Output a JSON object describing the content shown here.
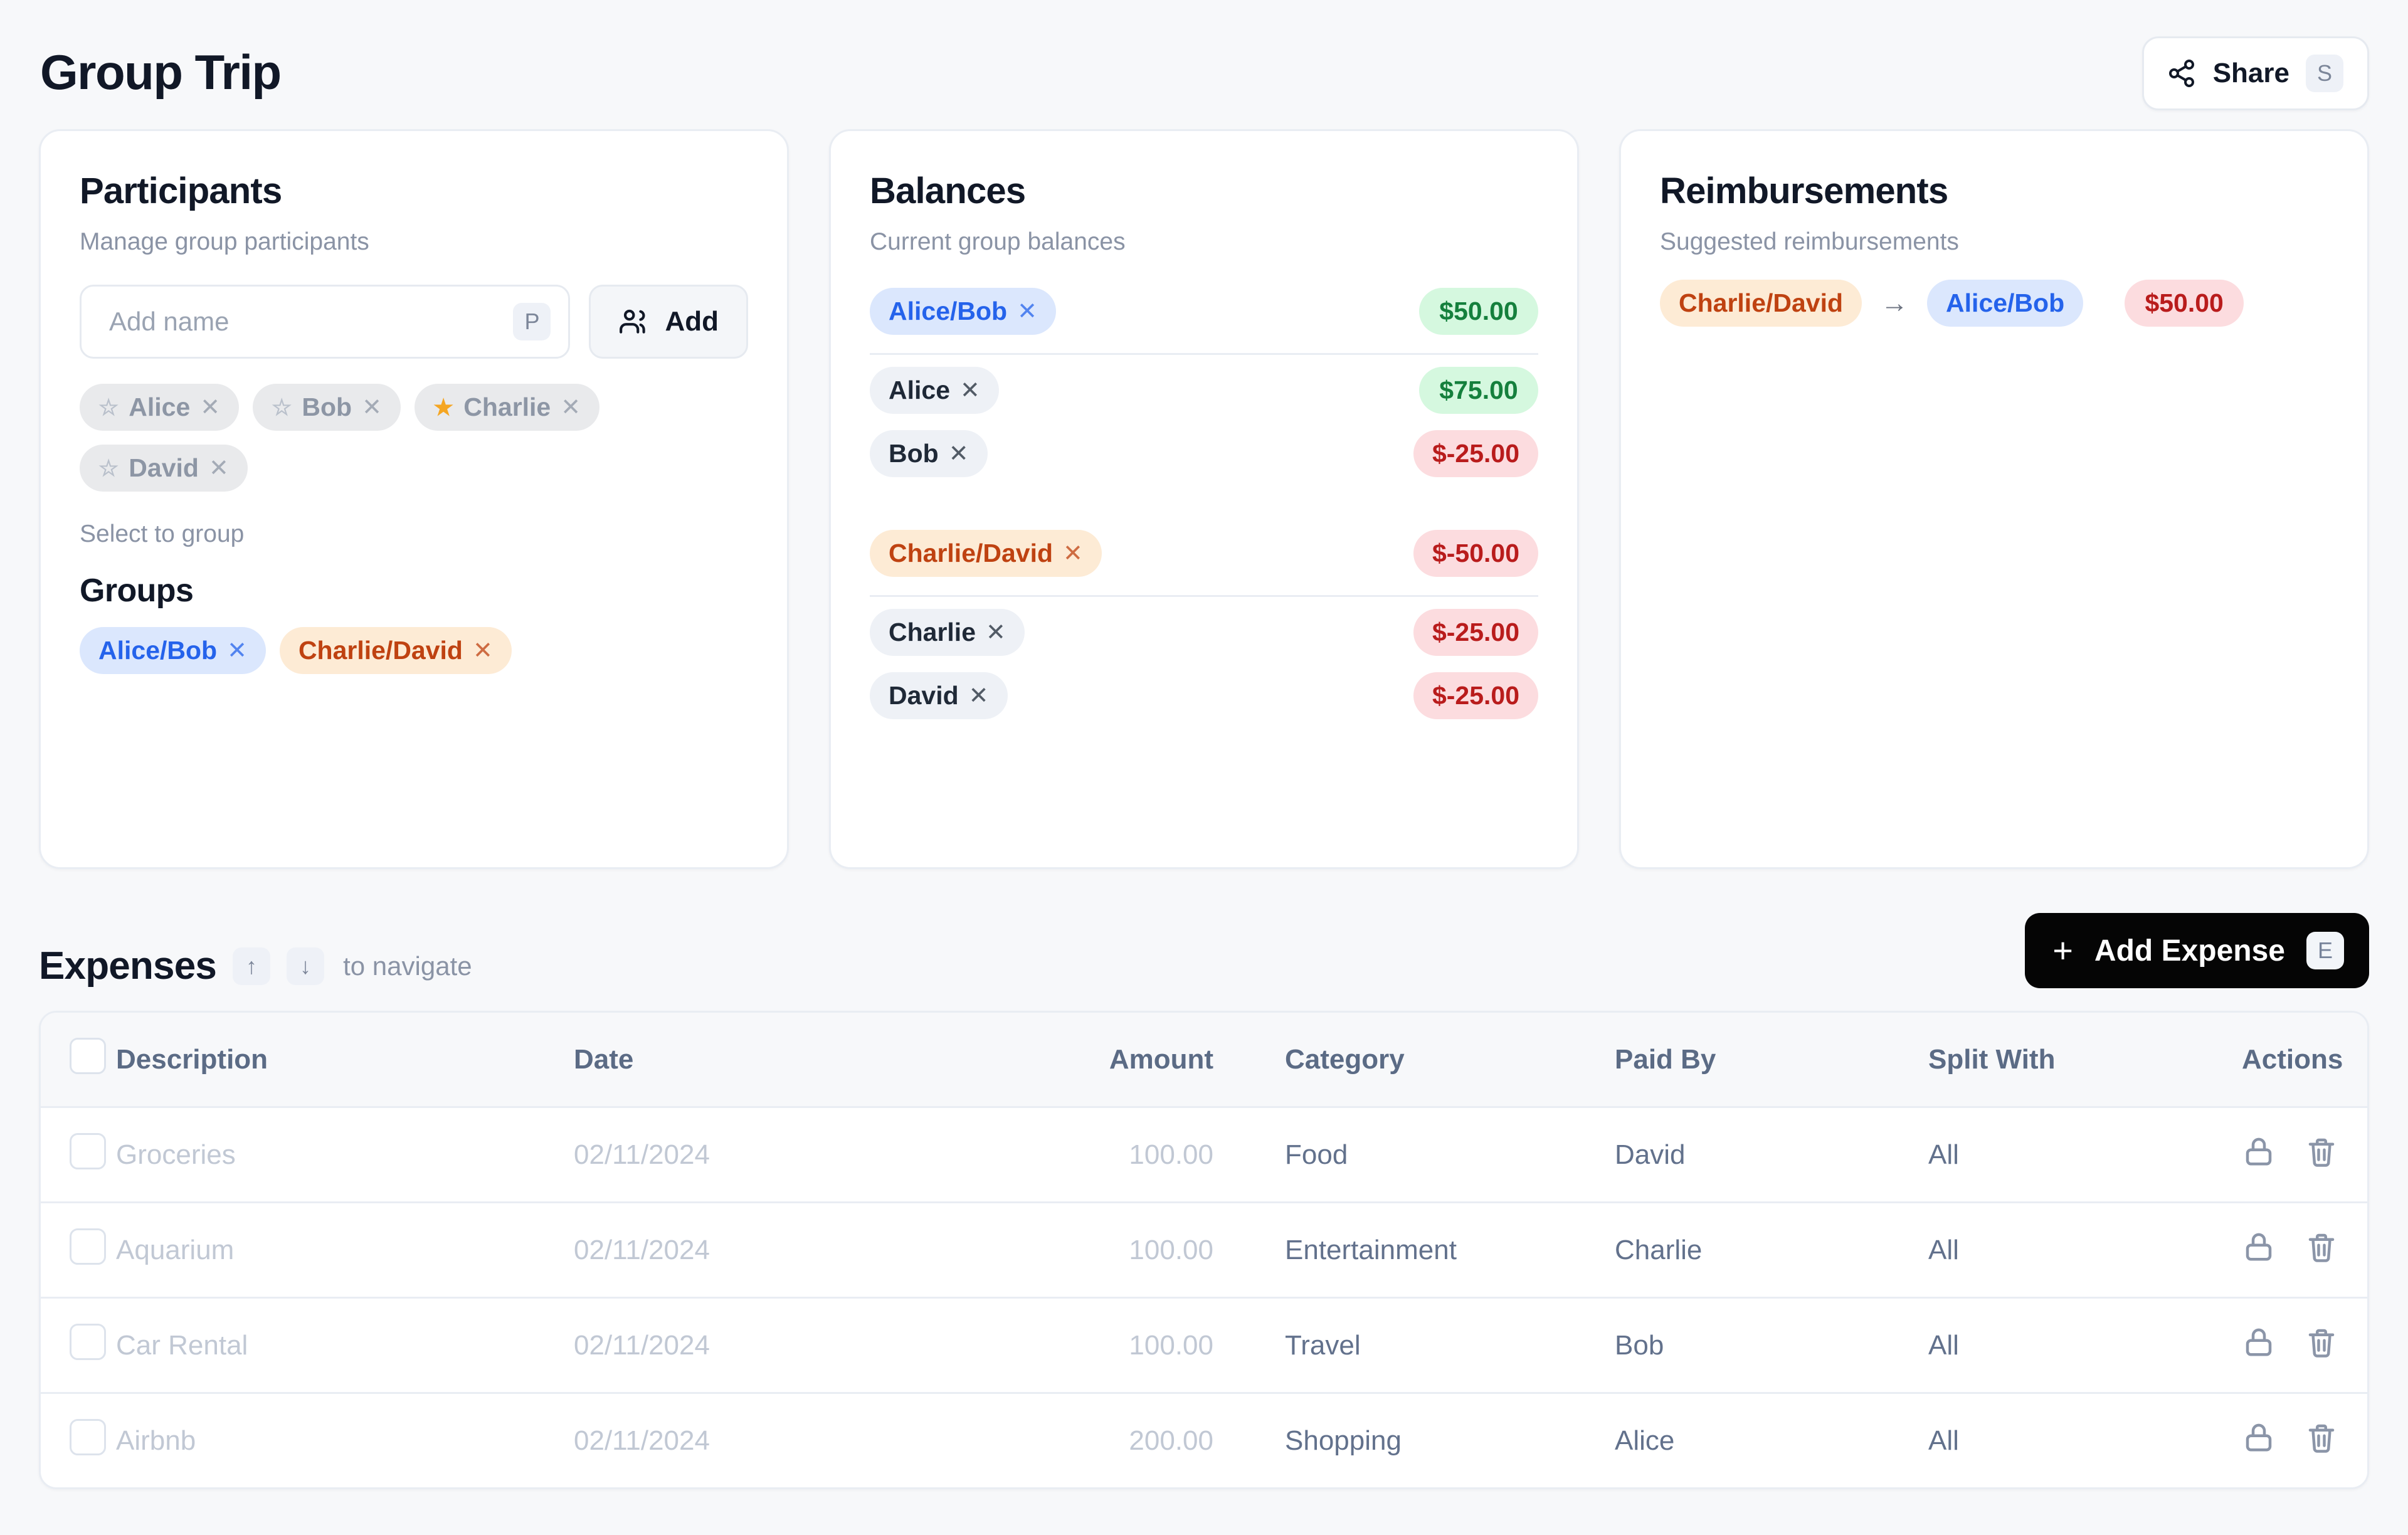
{
  "header": {
    "title": "Group Trip",
    "share_label": "Share",
    "share_shortcut": "S"
  },
  "participants": {
    "title": "Participants",
    "subtitle": "Manage group participants",
    "input_placeholder": "Add name",
    "input_value": "",
    "input_shortcut": "P",
    "add_label": "Add",
    "select_hint": "Select to group",
    "people": [
      {
        "name": "Alice",
        "starred": false
      },
      {
        "name": "Bob",
        "starred": false
      },
      {
        "name": "Charlie",
        "starred": true
      },
      {
        "name": "David",
        "starred": false
      }
    ],
    "groups_title": "Groups",
    "groups": [
      {
        "name": "Alice/Bob",
        "color": "blue"
      },
      {
        "name": "Charlie/David",
        "color": "orange"
      }
    ]
  },
  "balances": {
    "title": "Balances",
    "subtitle": "Current group balances",
    "sections": [
      {
        "group": {
          "name": "Alice/Bob",
          "color": "blue",
          "amount": "$50.00",
          "sign": "pos"
        },
        "members": [
          {
            "name": "Alice",
            "amount": "$75.00",
            "sign": "pos"
          },
          {
            "name": "Bob",
            "amount": "$-25.00",
            "sign": "neg"
          }
        ]
      },
      {
        "group": {
          "name": "Charlie/David",
          "color": "orange",
          "amount": "$-50.00",
          "sign": "neg"
        },
        "members": [
          {
            "name": "Charlie",
            "amount": "$-25.00",
            "sign": "neg"
          },
          {
            "name": "David",
            "amount": "$-25.00",
            "sign": "neg"
          }
        ]
      }
    ]
  },
  "reimbursements": {
    "title": "Reimbursements",
    "subtitle": "Suggested reimbursements",
    "rows": [
      {
        "from": "Charlie/David",
        "from_color": "orange",
        "to": "Alice/Bob",
        "to_color": "blue",
        "amount": "$50.00"
      }
    ]
  },
  "expenses": {
    "title": "Expenses",
    "nav_hint": "to navigate",
    "nav_up": "↑",
    "nav_down": "↓",
    "add_label": "Add Expense",
    "add_shortcut": "E",
    "columns": [
      "Description",
      "Date",
      "Amount",
      "Category",
      "Paid By",
      "Split With",
      "Actions"
    ],
    "rows": [
      {
        "description": "Groceries",
        "date": "02/11/2024",
        "amount": "100.00",
        "category": "Food",
        "paid_by": "David",
        "split_with": "All"
      },
      {
        "description": "Aquarium",
        "date": "02/11/2024",
        "amount": "100.00",
        "category": "Entertainment",
        "paid_by": "Charlie",
        "split_with": "All"
      },
      {
        "description": "Car Rental",
        "date": "02/11/2024",
        "amount": "100.00",
        "category": "Travel",
        "paid_by": "Bob",
        "split_with": "All"
      },
      {
        "description": "Airbnb",
        "date": "02/11/2024",
        "amount": "200.00",
        "category": "Shopping",
        "paid_by": "Alice",
        "split_with": "All"
      }
    ]
  },
  "colors": {
    "blue_bg": "#dbe7fd",
    "blue_text": "#2563eb",
    "orange_bg": "#fdebd5",
    "orange_text": "#bf4211",
    "positive_bg": "#d5f8df",
    "positive_text": "#15803d",
    "negative_bg": "#fcdcdf",
    "negative_text": "#b91c1c",
    "star_on": "#f5a623",
    "accent_dark": "#050505"
  }
}
